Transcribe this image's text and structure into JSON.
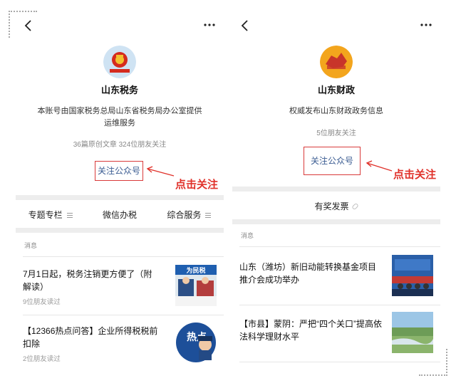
{
  "left": {
    "account_name": "山东税务",
    "description": "本账号由国家税务总局山东省税务局办公室提供运维服务",
    "stats": "36篇原创文章  324位朋友关注",
    "follow_label": "关注公众号",
    "annotation": "点击关注",
    "menu": [
      "专题专栏",
      "微信办税",
      "综合服务"
    ],
    "section_label": "消息",
    "articles": [
      {
        "title": "7月1日起，税务注销更方便了（附解读）",
        "meta": "9位朋友读过"
      },
      {
        "title": "【12366热点问答】企业所得税税前扣除",
        "meta": "2位朋友读过"
      }
    ],
    "thumb1_banner": "为民税",
    "thumb2_text": "热点"
  },
  "right": {
    "account_name": "山东财政",
    "description": "权威发布山东财政政务信息",
    "stats": "5位朋友关注",
    "follow_label": "关注公众号",
    "annotation": "点击关注",
    "menu_single": "有奖发票",
    "section_label": "消息",
    "articles": [
      {
        "title": "山东（潍坊）新旧动能转换基金项目推介会成功举办"
      },
      {
        "title": "【市县】蒙阴：严把“四个关口”提高依法科学理财水平"
      }
    ]
  },
  "colors": {
    "annotation_red": "#e0312a",
    "link_blue": "#3b5c92",
    "divider_gray": "#ededed"
  },
  "icons": [
    "back-arrow-icon",
    "more-dots-icon",
    "menu-lines-icon",
    "link-icon"
  ]
}
